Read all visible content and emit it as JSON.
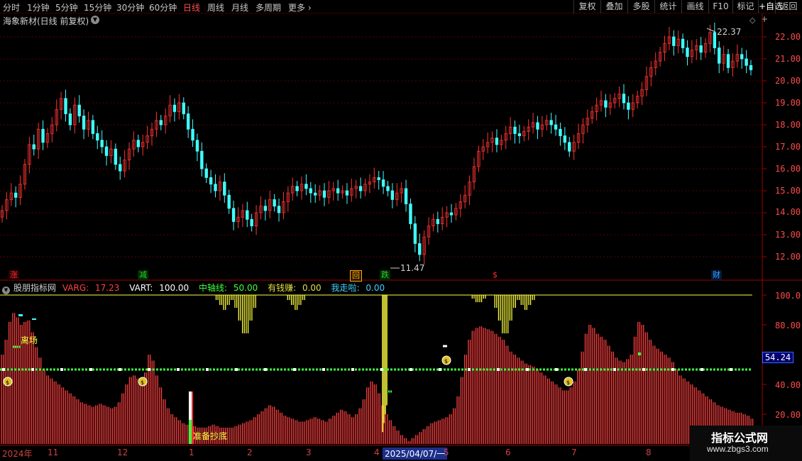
{
  "toolbar": {
    "periods": [
      "分时",
      "1分钟",
      "5分钟",
      "15分钟",
      "30分钟",
      "60分钟",
      "日线",
      "周线",
      "月线",
      "多周期",
      "更多"
    ],
    "active_period": "日线",
    "right_buttons": [
      "复权",
      "叠加",
      "多股",
      "统计",
      "画线",
      "F10",
      "标记",
      "+自选",
      "返回"
    ]
  },
  "stock": {
    "title": "海象新材(日线 前复权)"
  },
  "price_axis": {
    "labels": [
      "22.00",
      "21.00",
      "20.00",
      "19.00",
      "18.00",
      "17.00",
      "16.00",
      "15.00",
      "14.00",
      "13.00",
      "12.00"
    ]
  },
  "annotations": {
    "high": "22.37",
    "low": "11.47"
  },
  "markers": [
    {
      "text": "涨",
      "color": "#ff3030"
    },
    {
      "text": "减",
      "color": "#30d030"
    },
    {
      "text": "回",
      "color": "#ffaa00"
    },
    {
      "text": "跌",
      "color": "#30d030"
    },
    {
      "text": "$",
      "color": "#ff3030"
    },
    {
      "text": "财",
      "color": "#40a0ff"
    }
  ],
  "indicator": {
    "name": "股朋指标网",
    "varg_label": "VARG:",
    "varg_value": "17.23",
    "vart_label": "VART:",
    "vart_value": "100.00",
    "mid_label": "中轴线:",
    "mid_value": "50.00",
    "money_label": "有钱赚:",
    "money_value": "0.00",
    "leave_label": "我走啦:",
    "leave_value": "0.00",
    "current_value": "54.24",
    "leave_signal": "离场",
    "bottom_signal": "准备抄底"
  },
  "indicator_axis": {
    "labels": [
      "100.0",
      "80.00",
      "60.00",
      "40.00",
      "20.00"
    ]
  },
  "time_axis": {
    "labels": [
      "2024年",
      "11",
      "12",
      "1",
      "2",
      "3",
      "4",
      "2025/04/07/一",
      "5",
      "6",
      "7",
      "8"
    ],
    "selected": "2025/04/07/一"
  },
  "watermark": {
    "title": "指标公式网",
    "url": "www.zbgs3.com"
  },
  "colors": {
    "up": "#ff3333",
    "down": "#40ffff",
    "varg": "#ff4040",
    "vart": "#ffffff",
    "mid": "#40ff40",
    "money": "#ffff40",
    "leave": "#40d0ff"
  },
  "price_series": [
    {
      "o": 13.8,
      "c": 14.1
    },
    {
      "o": 14.1,
      "c": 14.6
    },
    {
      "o": 14.6,
      "c": 14.9
    },
    {
      "o": 14.9,
      "c": 14.7
    },
    {
      "o": 14.7,
      "c": 15.3
    },
    {
      "o": 15.3,
      "c": 16.2
    },
    {
      "o": 16.2,
      "c": 17.1
    },
    {
      "o": 17.1,
      "c": 16.9
    },
    {
      "o": 16.9,
      "c": 17.8
    },
    {
      "o": 17.8,
      "c": 17.2
    },
    {
      "o": 17.2,
      "c": 17.6
    },
    {
      "o": 17.6,
      "c": 18.0
    },
    {
      "o": 18.0,
      "c": 18.7
    },
    {
      "o": 18.7,
      "c": 19.2
    },
    {
      "o": 19.2,
      "c": 18.5
    },
    {
      "o": 18.5,
      "c": 18.0
    },
    {
      "o": 18.0,
      "c": 18.9
    },
    {
      "o": 18.9,
      "c": 18.4
    },
    {
      "o": 18.4,
      "c": 17.8
    },
    {
      "o": 17.8,
      "c": 18.2
    },
    {
      "o": 18.2,
      "c": 17.6
    },
    {
      "o": 17.6,
      "c": 17.3
    },
    {
      "o": 17.3,
      "c": 17.0
    },
    {
      "o": 17.0,
      "c": 16.6
    },
    {
      "o": 16.6,
      "c": 16.9
    },
    {
      "o": 16.9,
      "c": 16.2
    },
    {
      "o": 16.2,
      "c": 15.9
    },
    {
      "o": 15.9,
      "c": 16.4
    },
    {
      "o": 16.4,
      "c": 16.9
    },
    {
      "o": 16.9,
      "c": 17.3
    },
    {
      "o": 17.3,
      "c": 17.0
    },
    {
      "o": 17.0,
      "c": 17.2
    },
    {
      "o": 17.2,
      "c": 17.5
    },
    {
      "o": 17.5,
      "c": 17.8
    },
    {
      "o": 17.8,
      "c": 18.2
    },
    {
      "o": 18.2,
      "c": 18.0
    },
    {
      "o": 18.0,
      "c": 18.4
    },
    {
      "o": 18.4,
      "c": 18.9
    },
    {
      "o": 18.9,
      "c": 18.6
    },
    {
      "o": 18.6,
      "c": 19.0
    },
    {
      "o": 19.0,
      "c": 18.5
    },
    {
      "o": 18.5,
      "c": 17.8
    },
    {
      "o": 17.8,
      "c": 17.3
    },
    {
      "o": 17.3,
      "c": 16.8
    },
    {
      "o": 16.8,
      "c": 16.0
    },
    {
      "o": 16.0,
      "c": 15.6
    },
    {
      "o": 15.6,
      "c": 15.3
    },
    {
      "o": 15.3,
      "c": 15.0
    },
    {
      "o": 15.0,
      "c": 15.4
    },
    {
      "o": 15.4,
      "c": 14.8
    },
    {
      "o": 14.8,
      "c": 14.2
    },
    {
      "o": 14.2,
      "c": 13.6
    },
    {
      "o": 13.6,
      "c": 13.8
    },
    {
      "o": 13.8,
      "c": 14.1
    },
    {
      "o": 14.1,
      "c": 13.7
    },
    {
      "o": 13.7,
      "c": 13.4
    },
    {
      "o": 13.4,
      "c": 14.0
    },
    {
      "o": 14.0,
      "c": 14.3
    },
    {
      "o": 14.3,
      "c": 14.1
    },
    {
      "o": 14.1,
      "c": 14.6
    },
    {
      "o": 14.6,
      "c": 14.3
    },
    {
      "o": 14.3,
      "c": 14.0
    },
    {
      "o": 14.0,
      "c": 14.5
    },
    {
      "o": 14.5,
      "c": 14.9
    },
    {
      "o": 14.9,
      "c": 15.2
    },
    {
      "o": 15.2,
      "c": 15.0
    },
    {
      "o": 15.0,
      "c": 15.3
    },
    {
      "o": 15.3,
      "c": 15.1
    },
    {
      "o": 15.1,
      "c": 14.9
    },
    {
      "o": 14.9,
      "c": 14.8
    },
    {
      "o": 14.8,
      "c": 15.0
    },
    {
      "o": 15.0,
      "c": 14.7
    },
    {
      "o": 14.7,
      "c": 15.0
    },
    {
      "o": 15.0,
      "c": 15.1
    },
    {
      "o": 15.1,
      "c": 14.9
    },
    {
      "o": 14.9,
      "c": 15.0
    },
    {
      "o": 15.0,
      "c": 14.8
    },
    {
      "o": 14.8,
      "c": 15.1
    },
    {
      "o": 15.1,
      "c": 15.2
    },
    {
      "o": 15.2,
      "c": 15.0
    },
    {
      "o": 15.0,
      "c": 15.3
    },
    {
      "o": 15.3,
      "c": 15.4
    },
    {
      "o": 15.4,
      "c": 15.6
    },
    {
      "o": 15.6,
      "c": 15.5
    },
    {
      "o": 15.5,
      "c": 15.2
    },
    {
      "o": 15.2,
      "c": 15.0
    },
    {
      "o": 15.0,
      "c": 14.6
    },
    {
      "o": 14.6,
      "c": 14.9
    },
    {
      "o": 14.9,
      "c": 15.1
    },
    {
      "o": 15.1,
      "c": 14.4
    },
    {
      "o": 14.4,
      "c": 13.5
    },
    {
      "o": 13.5,
      "c": 12.6
    },
    {
      "o": 12.6,
      "c": 12.1
    },
    {
      "o": 12.1,
      "c": 12.9
    },
    {
      "o": 12.9,
      "c": 13.4
    },
    {
      "o": 13.4,
      "c": 13.7
    },
    {
      "o": 13.7,
      "c": 13.5
    },
    {
      "o": 13.5,
      "c": 13.8
    },
    {
      "o": 13.8,
      "c": 14.0
    },
    {
      "o": 14.0,
      "c": 13.9
    },
    {
      "o": 13.9,
      "c": 14.2
    },
    {
      "o": 14.2,
      "c": 14.5
    },
    {
      "o": 14.5,
      "c": 14.8
    },
    {
      "o": 14.8,
      "c": 15.4
    },
    {
      "o": 15.4,
      "c": 16.1
    },
    {
      "o": 16.1,
      "c": 16.8
    },
    {
      "o": 16.8,
      "c": 17.0
    },
    {
      "o": 17.0,
      "c": 17.2
    },
    {
      "o": 17.2,
      "c": 17.4
    },
    {
      "o": 17.4,
      "c": 17.1
    },
    {
      "o": 17.1,
      "c": 17.3
    },
    {
      "o": 17.3,
      "c": 17.6
    },
    {
      "o": 17.6,
      "c": 17.9
    },
    {
      "o": 17.9,
      "c": 17.6
    },
    {
      "o": 17.6,
      "c": 17.5
    },
    {
      "o": 17.5,
      "c": 17.7
    },
    {
      "o": 17.7,
      "c": 17.9
    },
    {
      "o": 17.9,
      "c": 18.1
    },
    {
      "o": 18.1,
      "c": 17.8
    },
    {
      "o": 17.8,
      "c": 18.0
    },
    {
      "o": 18.0,
      "c": 18.2
    },
    {
      "o": 18.2,
      "c": 18.0
    },
    {
      "o": 18.0,
      "c": 17.8
    },
    {
      "o": 17.8,
      "c": 17.5
    },
    {
      "o": 17.5,
      "c": 17.2
    },
    {
      "o": 17.2,
      "c": 16.8
    },
    {
      "o": 16.8,
      "c": 17.2
    },
    {
      "o": 17.2,
      "c": 17.6
    },
    {
      "o": 17.6,
      "c": 18.0
    },
    {
      "o": 18.0,
      "c": 18.3
    },
    {
      "o": 18.3,
      "c": 18.6
    },
    {
      "o": 18.6,
      "c": 18.9
    },
    {
      "o": 18.9,
      "c": 19.1
    },
    {
      "o": 19.1,
      "c": 18.8
    },
    {
      "o": 18.8,
      "c": 19.0
    },
    {
      "o": 19.0,
      "c": 19.2
    },
    {
      "o": 19.2,
      "c": 19.4
    },
    {
      "o": 19.4,
      "c": 19.0
    },
    {
      "o": 19.0,
      "c": 18.7
    },
    {
      "o": 18.7,
      "c": 19.0
    },
    {
      "o": 19.0,
      "c": 19.3
    },
    {
      "o": 19.3,
      "c": 19.6
    },
    {
      "o": 19.6,
      "c": 20.2
    },
    {
      "o": 20.2,
      "c": 20.6
    },
    {
      "o": 20.6,
      "c": 20.9
    },
    {
      "o": 20.9,
      "c": 21.3
    },
    {
      "o": 21.3,
      "c": 21.7
    },
    {
      "o": 21.7,
      "c": 22.0
    },
    {
      "o": 22.0,
      "c": 21.6
    },
    {
      "o": 21.6,
      "c": 21.9
    },
    {
      "o": 21.9,
      "c": 21.5
    },
    {
      "o": 21.5,
      "c": 21.1
    },
    {
      "o": 21.1,
      "c": 21.4
    },
    {
      "o": 21.4,
      "c": 21.6
    },
    {
      "o": 21.6,
      "c": 21.3
    },
    {
      "o": 21.3,
      "c": 21.7
    },
    {
      "o": 21.7,
      "c": 22.2
    },
    {
      "o": 22.2,
      "c": 21.5
    },
    {
      "o": 21.5,
      "c": 20.8
    },
    {
      "o": 20.8,
      "c": 21.2
    },
    {
      "o": 21.2,
      "c": 20.6
    },
    {
      "o": 20.6,
      "c": 20.9
    },
    {
      "o": 20.9,
      "c": 21.2
    },
    {
      "o": 21.2,
      "c": 21.0
    },
    {
      "o": 21.0,
      "c": 20.7
    },
    {
      "o": 20.7,
      "c": 20.5
    }
  ],
  "indicator_series": {
    "varg": [
      60,
      70,
      82,
      88,
      85,
      80,
      82,
      83,
      75,
      65,
      58,
      50,
      46,
      44,
      42,
      40,
      38,
      36,
      34,
      32,
      30,
      28,
      27,
      26,
      25,
      26,
      27,
      26,
      25,
      24,
      25,
      28,
      34,
      40,
      45,
      46,
      44,
      40,
      48,
      60,
      56,
      46,
      38,
      30,
      24,
      20,
      18,
      16,
      14,
      13,
      12,
      12,
      11,
      11,
      11,
      12,
      13,
      12,
      11,
      11,
      11,
      11,
      12,
      13,
      14,
      15,
      16,
      18,
      20,
      22,
      24,
      26,
      25,
      23,
      21,
      19,
      18,
      17,
      16,
      15,
      15,
      16,
      17,
      18,
      17,
      16,
      15,
      17,
      19,
      21,
      23,
      22,
      20,
      18,
      20,
      24,
      30,
      38,
      42,
      40,
      34,
      26,
      20,
      16,
      12,
      9,
      6,
      4,
      2,
      4,
      6,
      8,
      10,
      12,
      14,
      15,
      16,
      17,
      18,
      20,
      24,
      32,
      45,
      60,
      70,
      76,
      78,
      79,
      78,
      77,
      76,
      74,
      72,
      70,
      66,
      62,
      60,
      58,
      56,
      54,
      53,
      52,
      50,
      48,
      46,
      44,
      42,
      40,
      38,
      36,
      36,
      38,
      42,
      50,
      62,
      74,
      80,
      78,
      74,
      72,
      70,
      66,
      62,
      58,
      56,
      55,
      57,
      60,
      72,
      82,
      80,
      75,
      70,
      66,
      64,
      62,
      60,
      58,
      55,
      50,
      46,
      44,
      42,
      40,
      38,
      36,
      34,
      32,
      30,
      28,
      26,
      25,
      24,
      23,
      22,
      21,
      21,
      20,
      19,
      17
    ],
    "vart_dips": [
      [
        57,
        61,
        90
      ],
      [
        62,
        67,
        70
      ],
      [
        76,
        80,
        90
      ],
      [
        125,
        128,
        94
      ],
      [
        131,
        136,
        70
      ],
      [
        137,
        141,
        90
      ]
    ]
  }
}
